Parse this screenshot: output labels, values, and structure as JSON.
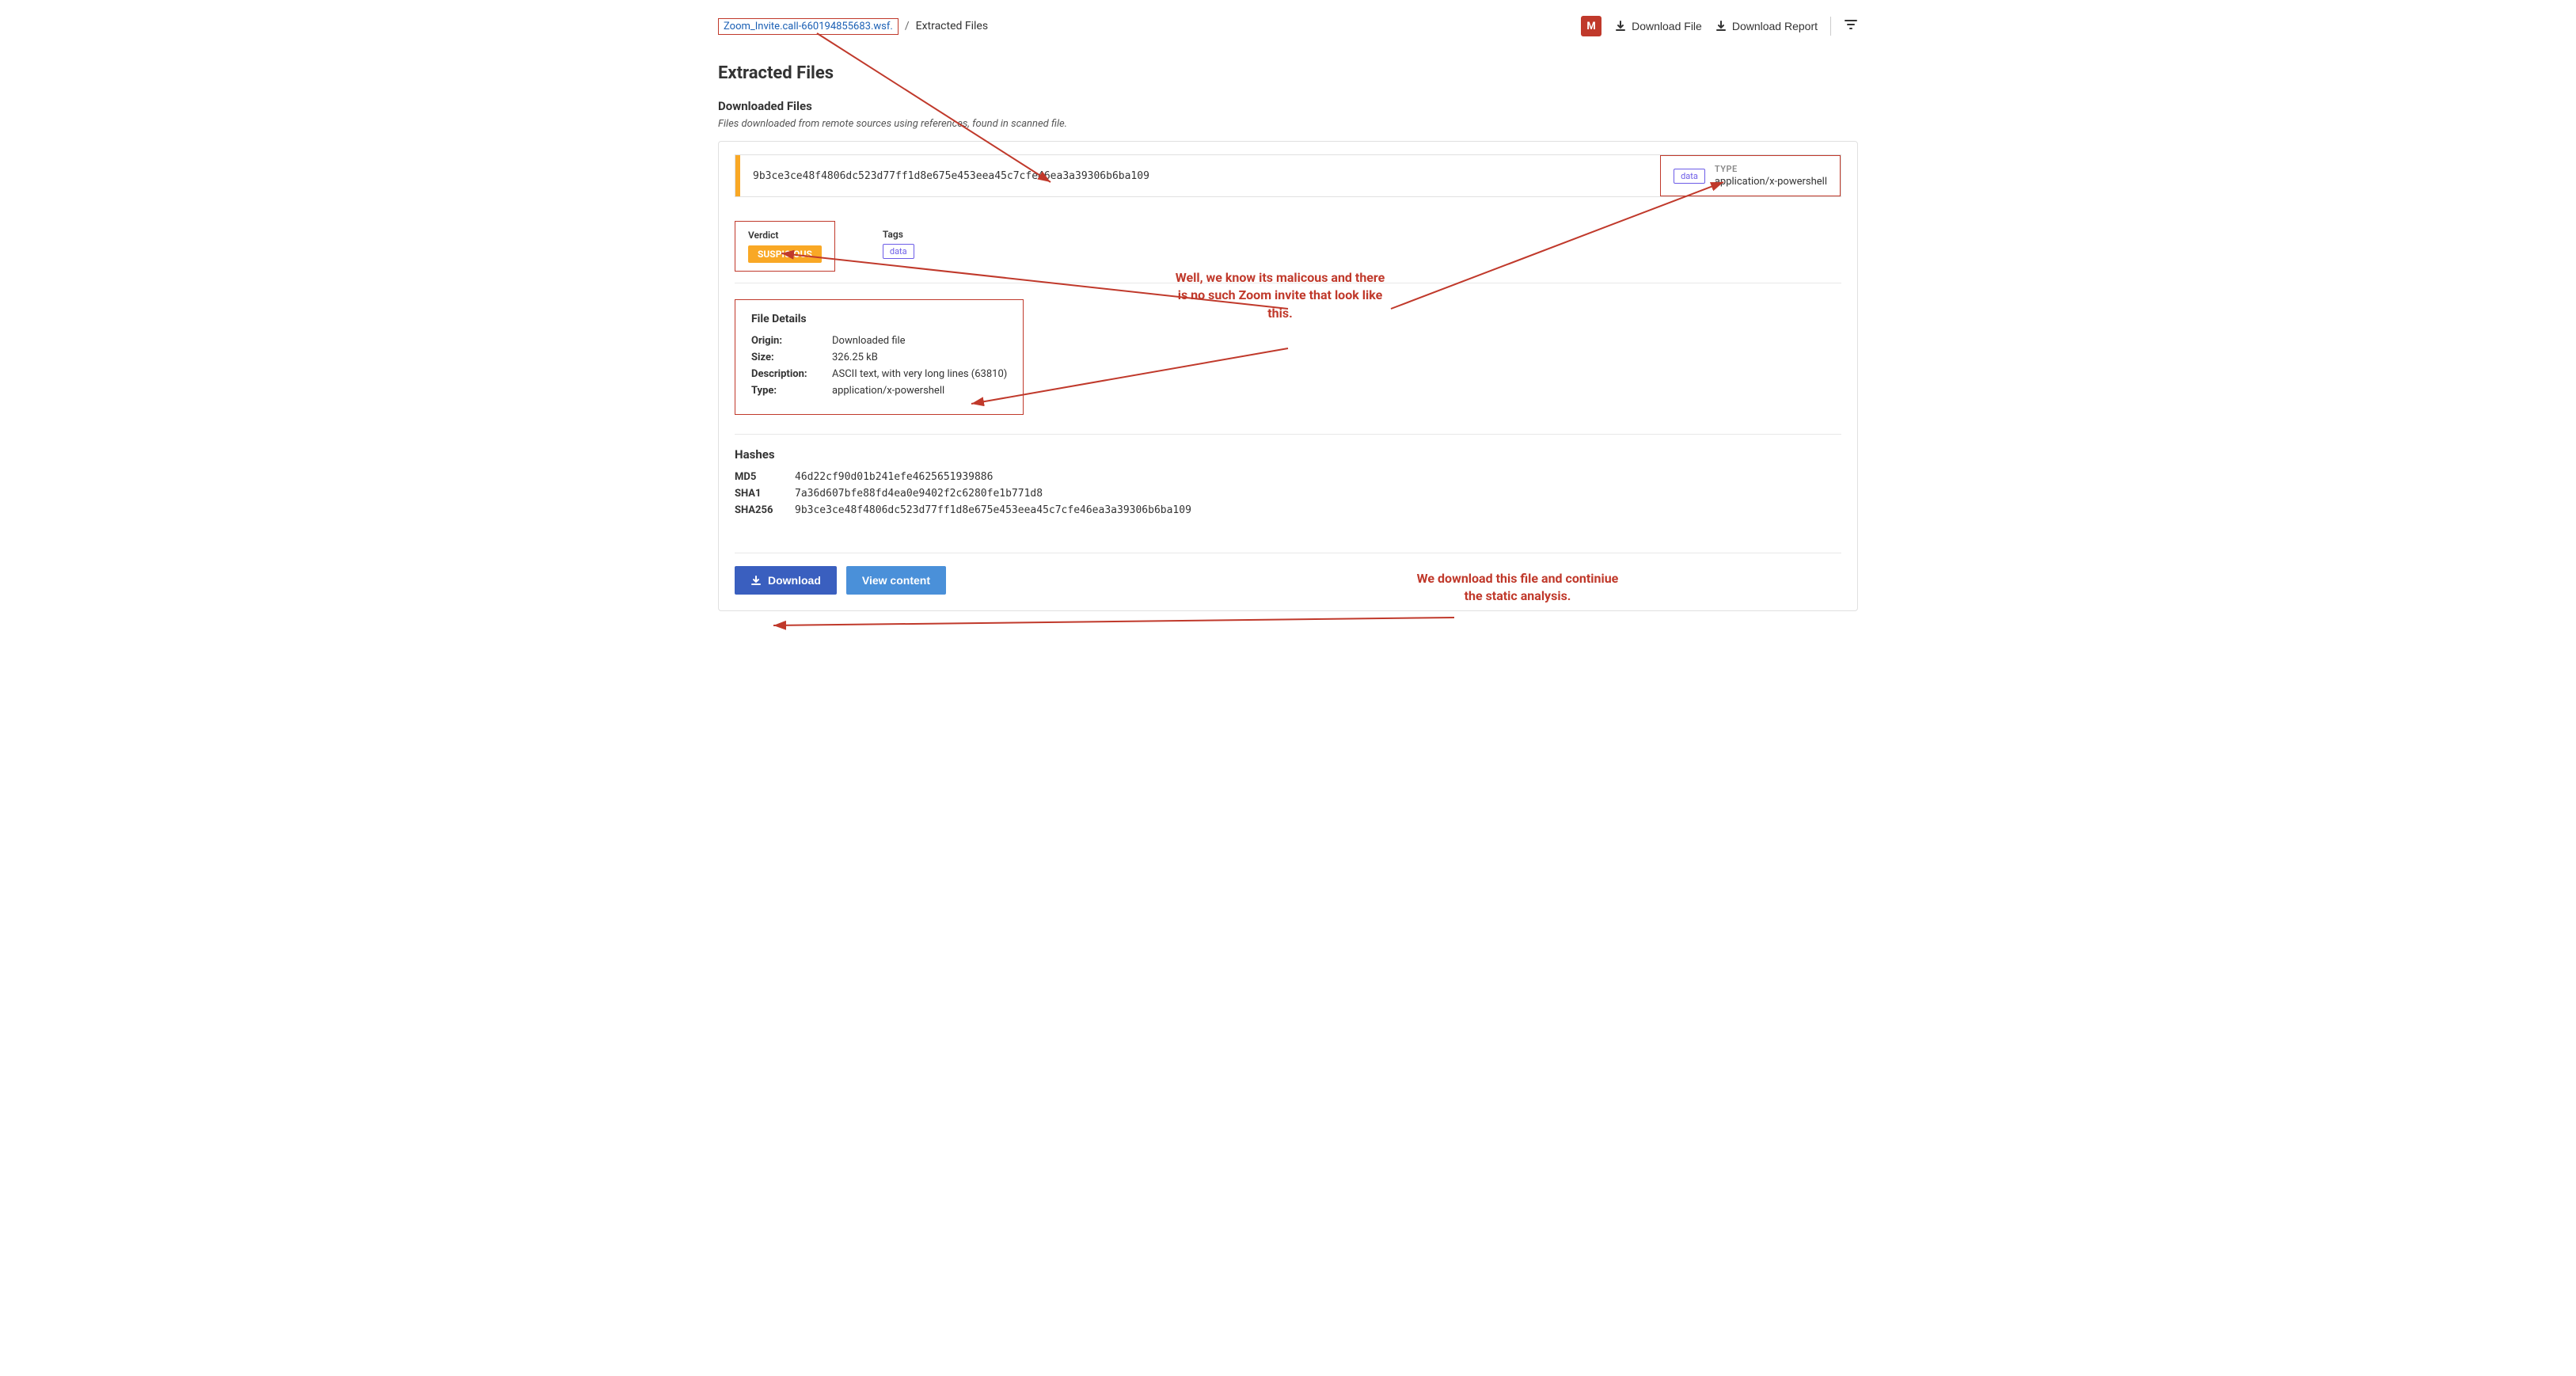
{
  "breadcrumb": {
    "file_link": "Zoom_Invite.call-660194855683.wsf.",
    "separator": "/",
    "current_page": "Extracted Files"
  },
  "header": {
    "m_badge": "M",
    "download_file_label": "Download File",
    "download_report_label": "Download Report"
  },
  "page_title": "Extracted Files",
  "downloaded_files": {
    "section_title": "Downloaded Files",
    "section_subtitle": "Files downloaded from remote sources using references, found in scanned file.",
    "file_hash": "9b3ce3ce48f4806dc523d77ff1d8e675e453eea45c7cfe46ea3a39306b6ba109",
    "type_heading": "TYPE",
    "type_value": "application/x-powershell",
    "type_tag": "data"
  },
  "verdict": {
    "label": "Verdict",
    "badge": "SUSPICIOUS"
  },
  "tags": {
    "label": "Tags",
    "tag": "data"
  },
  "file_details": {
    "title": "File Details",
    "origin_label": "Origin:",
    "origin_value": "Downloaded file",
    "size_label": "Size:",
    "size_value": "326.25 kB",
    "description_label": "Description:",
    "description_value": "ASCII text, with very long lines (63810)",
    "type_label": "Type:",
    "type_value": "application/x-powershell"
  },
  "hashes": {
    "title": "Hashes",
    "md5_label": "MD5",
    "md5_value": "46d22cf90d01b241efe4625651939886",
    "sha1_label": "SHA1",
    "sha1_value": "7a36d607bfe88fd4ea0e9402f2c6280fe1b771d8",
    "sha256_label": "SHA256",
    "sha256_value": "9b3ce3ce48f4806dc523d77ff1d8e675e453eea45c7cfe46ea3a39306b6ba109"
  },
  "buttons": {
    "download_label": "Download",
    "view_content_label": "View content"
  },
  "annotations": {
    "malicious_note": "Well, we know its malicous and there is no such Zoom invite that look like this.",
    "download_note": "We download this file and continiue the static analysis."
  }
}
